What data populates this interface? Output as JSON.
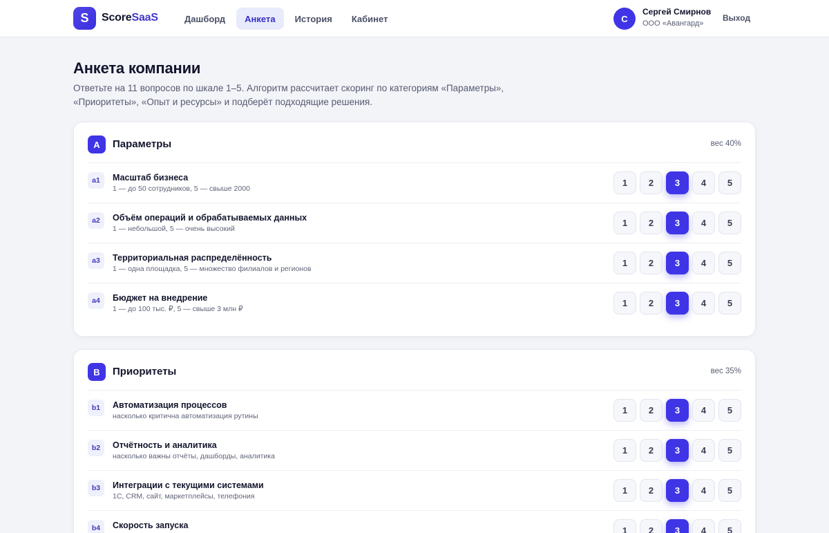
{
  "brand": {
    "mark": "S",
    "name_a": "Score",
    "name_b": "SaaS"
  },
  "nav": [
    {
      "label": "Дашборд",
      "active": false
    },
    {
      "label": "Анкета",
      "active": true
    },
    {
      "label": "История",
      "active": false
    },
    {
      "label": "Кабинет",
      "active": false
    }
  ],
  "user": {
    "initial": "С",
    "name": "Сергей Смирнов",
    "org": "ООО «Авангард»",
    "logout": "Выход"
  },
  "page": {
    "title": "Анкета компании",
    "description": "Ответьте на 11 вопросов по шкале 1–5. Алгоритм рассчитает скоринг по категориям «Параметры», «Приоритеты», «Опыт и ресурсы» и подберёт подходящие решения."
  },
  "scale_options": [
    "1",
    "2",
    "3",
    "4",
    "5"
  ],
  "categories": [
    {
      "letter": "A",
      "title": "Параметры",
      "weight": "вес 40%",
      "questions": [
        {
          "code": "a1",
          "title": "Масштаб бизнеса",
          "hint": "1 — до 50 сотрудников, 5 — свыше 2000",
          "selected": 3
        },
        {
          "code": "a2",
          "title": "Объём операций и обрабатываемых данных",
          "hint": "1 — небольшой, 5 — очень высокий",
          "selected": 3
        },
        {
          "code": "a3",
          "title": "Территориальная распределённость",
          "hint": "1 — одна площадка, 5 — множество филиалов и регионов",
          "selected": 3
        },
        {
          "code": "a4",
          "title": "Бюджет на внедрение",
          "hint": "1 — до 100 тыс. ₽, 5 — свыше 3 млн ₽",
          "selected": 3
        }
      ]
    },
    {
      "letter": "B",
      "title": "Приоритеты",
      "weight": "вес 35%",
      "questions": [
        {
          "code": "b1",
          "title": "Автоматизация процессов",
          "hint": "насколько критична автоматизация рутины",
          "selected": 3
        },
        {
          "code": "b2",
          "title": "Отчётность и аналитика",
          "hint": "насколько важны отчёты, дашборды, аналитика",
          "selected": 3
        },
        {
          "code": "b3",
          "title": "Интеграции с текущими системами",
          "hint": "1С, CRM, сайт, маркетплейсы, телефония",
          "selected": 3
        },
        {
          "code": "b4",
          "title": "Скорость запуска",
          "hint": "",
          "selected": 3
        }
      ]
    }
  ]
}
